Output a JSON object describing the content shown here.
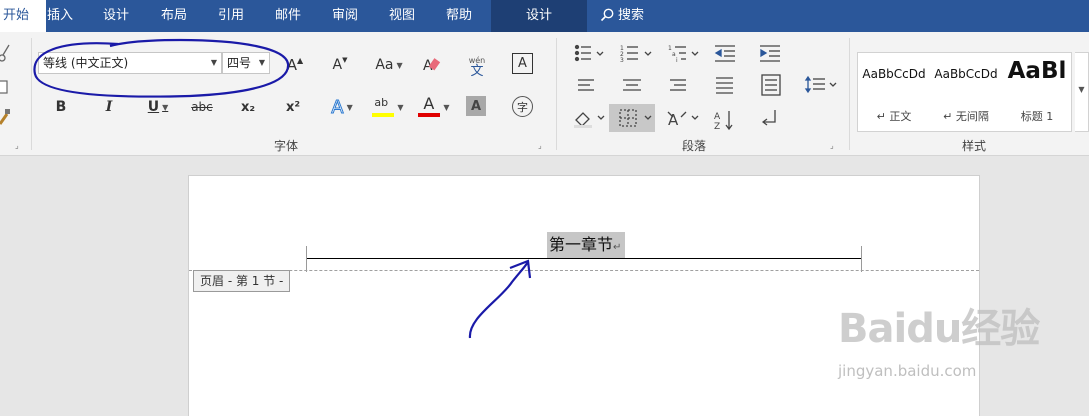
{
  "tabs": [
    {
      "label": "开始",
      "state": "active-cut"
    },
    {
      "label": "插入"
    },
    {
      "label": "设计"
    },
    {
      "label": "布局"
    },
    {
      "label": "引用"
    },
    {
      "label": "邮件"
    },
    {
      "label": "审阅"
    },
    {
      "label": "视图"
    },
    {
      "label": "帮助"
    },
    {
      "label": "设计",
      "state": "context"
    }
  ],
  "search": {
    "label": "搜索",
    "icon": "search-icon"
  },
  "font_group": {
    "label": "字体",
    "font_name": "等线 (中文正文)",
    "font_size": "四号",
    "buttons": {
      "bold": "B",
      "italic": "I",
      "underline": "U",
      "strike": "abc",
      "subscript": "x₂",
      "superscript": "x²",
      "grow": "A",
      "shrink": "A",
      "change_case": "Aa",
      "phonetic_top": "wén",
      "phonetic_bottom": "文",
      "char_border": "A",
      "text_effects": "A",
      "highlight": "ab",
      "font_color": "A",
      "char_shading": "A",
      "enclose": "字"
    }
  },
  "paragraph_group": {
    "label": "段落",
    "icons": [
      "bullets-icon",
      "numbering-icon",
      "multilevel-icon",
      "decrease-indent-icon",
      "increase-indent-icon",
      "align-left-icon",
      "align-center-icon",
      "align-right-icon",
      "justify-icon",
      "distributed-icon",
      "line-spacing-icon",
      "shading-icon",
      "borders-icon",
      "chinese-layout-icon",
      "sort-icon",
      "show-marks-icon"
    ]
  },
  "styles_group": {
    "label": "样式",
    "items": [
      {
        "sample": "AaBbCcDd",
        "name": "正文",
        "prefix": "↵"
      },
      {
        "sample": "AaBbCcDd",
        "name": "无间隔",
        "prefix": "↵"
      },
      {
        "sample": "AaBl",
        "name": "标题 1",
        "prefix": ""
      }
    ]
  },
  "document": {
    "header_text": "第一章节",
    "paragraph_mark": "↵",
    "header_tag": "页眉 - 第 1 节 -"
  },
  "watermark": {
    "logo": "Baidu经验",
    "url": "jingyan.baidu.com"
  },
  "colors": {
    "tab_bar": "#2b579a",
    "highlight_yellow": "#ffff00",
    "font_red": "#e00000",
    "annotation_blue": "#1a1aa8"
  }
}
